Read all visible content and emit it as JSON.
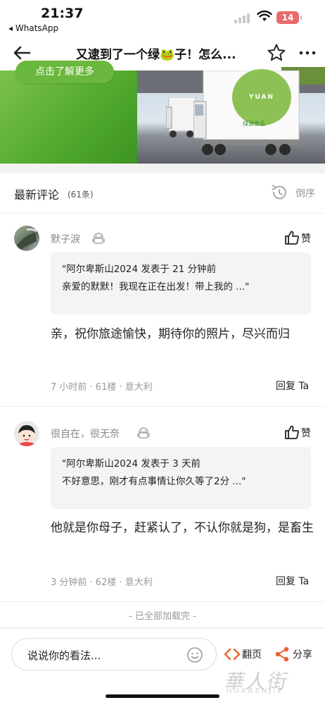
{
  "status_bar": {
    "time": "21:37",
    "back_app": "◂ WhatsApp",
    "battery": "14"
  },
  "nav": {
    "title": "又逮到了一个绿🐸子！怎么..."
  },
  "banner": {
    "cta": "点击了解更多",
    "logo_text": "YUAN",
    "logo_sub": "绿源食品"
  },
  "comments_section": {
    "title": "最新评论",
    "count": "(61条)",
    "sort_label": "倒序"
  },
  "comments": [
    {
      "username": "默子淚",
      "like_label": "赞",
      "quote_line1": "\"阿尔卑斯山2024 发表于 21 分钟前",
      "quote_line2": "亲爱的默默！我现在正在出发！带上我的 ...\"",
      "text": "亲，祝你旅途愉快，期待你的照片，尽兴而归",
      "meta": "7 小时前 · 61楼 · 意大利",
      "reply_label": "回复 Ta"
    },
    {
      "username": "很自在，很无奈",
      "like_label": "赞",
      "quote_line1": "\"阿尔卑斯山2024 发表于 3 天前",
      "quote_line2": "不好意思，刚才有点事情让你久等了2分 ...\"",
      "text": "他就是你母子，赶紧认了，不认你就是狗，是畜生",
      "meta": "3 分钟前 · 62楼 · 意大利",
      "reply_label": "回复 Ta"
    }
  ],
  "end_note": "- 已全部加载完 -",
  "bottom_bar": {
    "input_placeholder": "说说你的看法...",
    "page_label": "翻页",
    "share_label": "分享"
  },
  "watermark": {
    "main": "華人街",
    "sub": "HUARENJIE"
  },
  "colors": {
    "accent_green": "#4fa82c",
    "accent_orange": "#e8642c",
    "battery_red": "#e86a6a"
  }
}
